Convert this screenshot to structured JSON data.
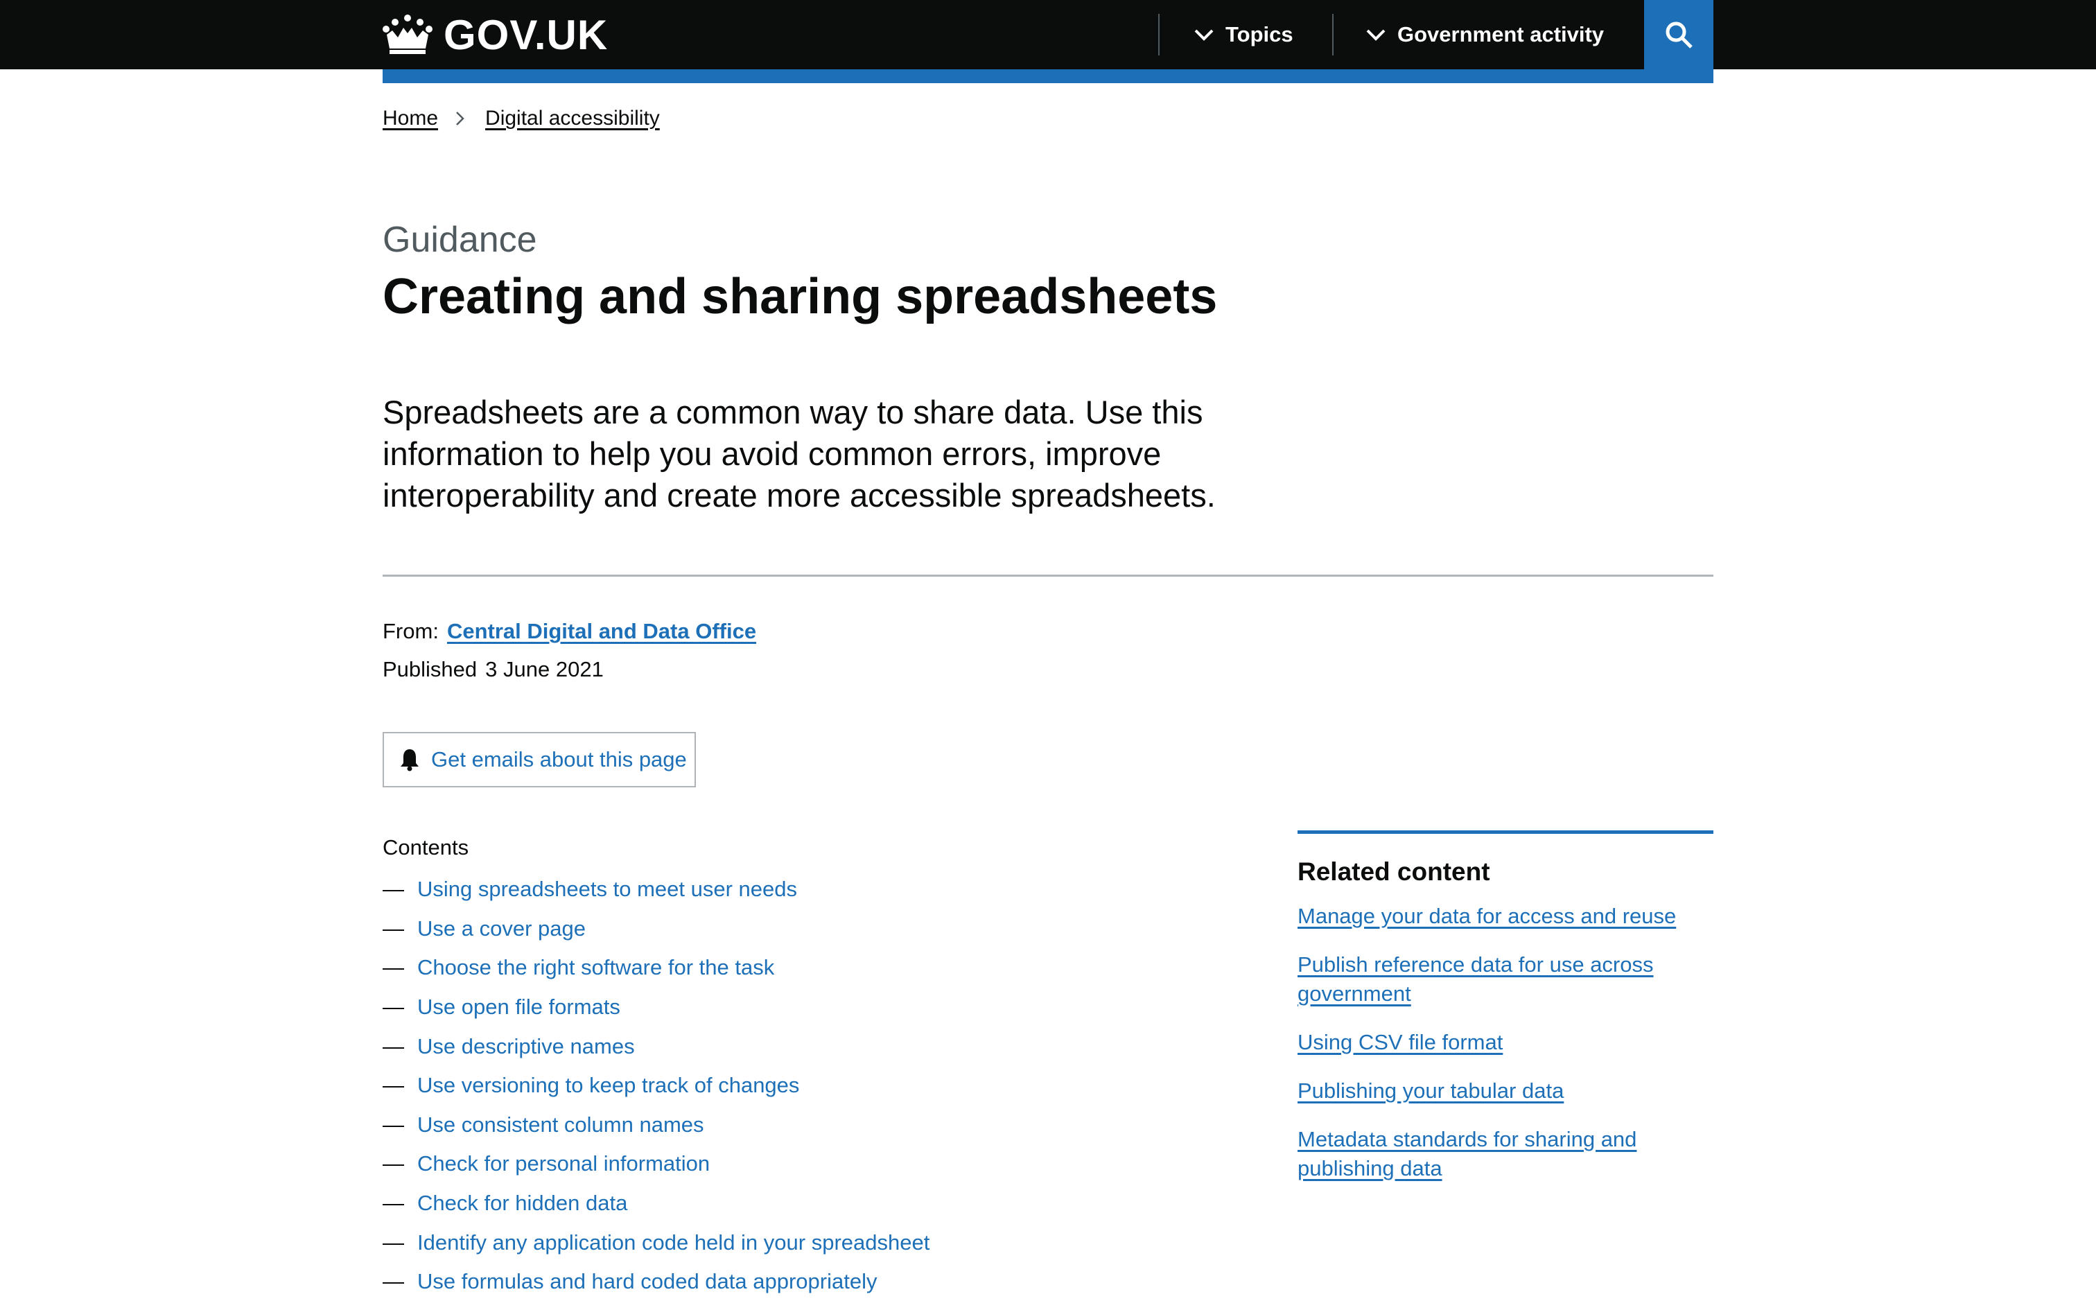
{
  "header": {
    "logo_text": "GOV.UK",
    "nav": [
      {
        "label": "Topics"
      },
      {
        "label": "Government activity"
      }
    ],
    "search_icon": "search-icon"
  },
  "breadcrumb": [
    {
      "label": "Home"
    },
    {
      "label": "Digital accessibility"
    }
  ],
  "page": {
    "caption": "Guidance",
    "title": "Creating and sharing spreadsheets",
    "lead": "Spreadsheets are a common way to share data. Use this information to help you avoid common errors, improve interoperability and create more accessible spreadsheets.",
    "from_label": "From:",
    "from_org": "Central Digital and Data Office",
    "published_label": "Published",
    "published_date": "3 June 2021",
    "email_button": "Get emails about this page"
  },
  "contents": {
    "heading": "Contents",
    "dash": "—",
    "items": [
      "Using spreadsheets to meet user needs",
      "Use a cover page",
      "Choose the right software for the task",
      "Use open file formats",
      "Use descriptive names",
      "Use versioning to keep track of changes",
      "Use consistent column names",
      "Check for personal information",
      "Check for hidden data",
      "Identify any application code held in your spreadsheet",
      "Use formulas and hard coded data appropriately"
    ]
  },
  "related": {
    "heading": "Related content",
    "links": [
      "Manage your data for access and reuse",
      "Publish reference data for use across government",
      "Using CSV file format",
      "Publishing your tabular data",
      "Metadata standards for sharing and publishing data"
    ]
  },
  "colors": {
    "header_bg": "#0b0c0c",
    "link": "#1d70b8",
    "accent": "#1d70b8",
    "secondary_text": "#505a5f"
  }
}
